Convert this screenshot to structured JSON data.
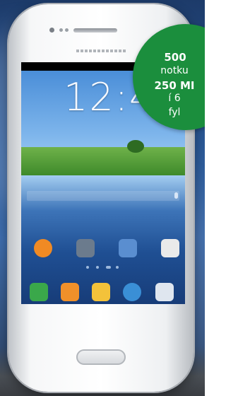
{
  "phone_screen": {
    "clock": "12:4",
    "apps_row1": [
      {
        "icon": "chaton-icon",
        "color": "#f08a24"
      },
      {
        "icon": "camera-icon",
        "color": "#6b7b8d"
      },
      {
        "icon": "gallery-icon",
        "color": "#5a8ed0"
      },
      {
        "icon": "play-store-icon",
        "color": "#eaeaea"
      }
    ],
    "dock": [
      {
        "icon": "phone-icon",
        "color": "#3aa84a"
      },
      {
        "icon": "contacts-icon",
        "color": "#f0902a"
      },
      {
        "icon": "messaging-icon",
        "color": "#f3c23a"
      },
      {
        "icon": "internet-icon",
        "color": "#3a8fd6"
      },
      {
        "icon": "apps-icon",
        "color": "#dfe6ef"
      }
    ]
  },
  "promo_badge": {
    "line1": "500",
    "line2": "notku",
    "line3": "250 MI",
    "line4": "í 6",
    "line5": "fyl",
    "color": "#1b8e3d"
  }
}
